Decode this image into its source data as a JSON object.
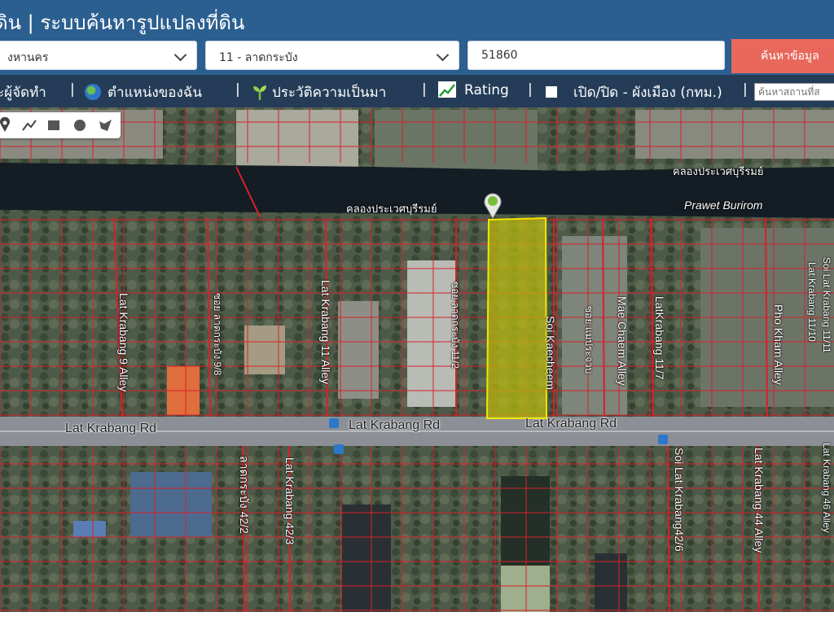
{
  "header": {
    "title": "ดิน | ระบบค้นหารูปแปลงที่ดิน"
  },
  "search": {
    "province_value": "งหานคร",
    "district_value": "11 - ลาดกระบัง",
    "code_value": "51860",
    "search_button": "ค้นหาข้อมูล"
  },
  "menu": {
    "item_editor": "ะผู้จัดทำ",
    "item_location": "ตำแหน่งของฉัน",
    "item_history": "ประวัติความเป็นมา",
    "item_rating": "Rating",
    "item_zoning": "เปิด/ปิด - ผังเมือง (กทม.)",
    "place_placeholder": "ค้นหาสถานที่ส"
  },
  "map": {
    "labels": {
      "canal_th_top": "คลองประเวศบุรีรมย์",
      "canal_th_mid": "คลองประเวศบุรีรมย์",
      "canal_en": "Prawet Burirom",
      "road_left": "Lat Krabang Rd",
      "road_mid": "Lat Krabang Rd",
      "road_right": "Lat Krabang Rd",
      "alley_9": "Lat Krabang 9 Alley",
      "soi_9_8": "ซอย ลาดกระบัง 9/8",
      "alley_11": "Lat Krabang 11 Alley",
      "soi_11_2": "ซอย ลาดกระบัง 11/2",
      "soi_kaecheem": "Soi Kaecheem",
      "soi_maecham": "ซอย แม่ประจวบ",
      "mae_chaem": "Mae Chaem Alley",
      "alley_11_7": "LatKrabang 11/7",
      "pho_kham": "Pho Kham Alley",
      "alley_11_10": "Lat Krabang 11/10",
      "alley_11_11": "Soi Lat Krabang 11/11",
      "soi_42_2": "ลาดกระบัง 42/2",
      "alley_42_3": "Lat Krabang 42/3",
      "soi_42_6": "Soi Lat Krabang42/6",
      "alley_44": "Lat Krabang 44 Alley",
      "alley_46": "Lat Krabang 46 Alley"
    },
    "colors": {
      "parcel_line": "#d9202a",
      "highlight_fill": "#b8b810",
      "highlight_stroke": "#f2e600",
      "canal": "#141d24",
      "road": "#8c9096"
    }
  },
  "draw_tools": [
    "marker-icon",
    "polyline-icon",
    "rectangle-icon",
    "circle-icon",
    "polygon-icon"
  ]
}
